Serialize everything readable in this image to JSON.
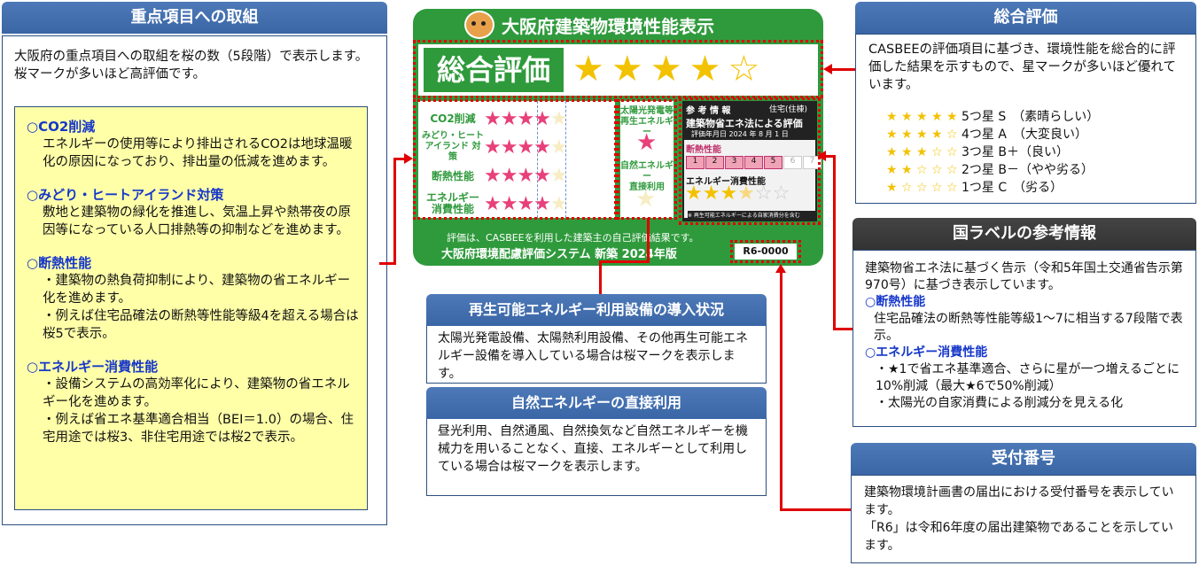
{
  "left": {
    "title": "重点項目への取組",
    "intro": "大阪府の重点項目への取組を桜の数（5段階）で表示します。桜マークが多いほど高評価です。",
    "sections": [
      {
        "heading": "○CO2削減",
        "body": "エネルギーの使用等により排出されるCO2は地球温暖化の原因になっており、排出量の低減を進めます。"
      },
      {
        "heading": "○みどり・ヒートアイランド対策",
        "body": "敷地と建築物の緑化を推進し、気温上昇や熱帯夜の原因等になっている人口排熱等の抑制などを進めます。"
      },
      {
        "heading": "○断熱性能",
        "body": "・建築物の熱負荷抑制により、建築物の省エネルギー化を進めます。\n・例えば住宅品確法の断熱等性能等級4を超える場合は桜5で表示。"
      },
      {
        "heading": "○エネルギー消費性能",
        "body": "・設備システムの高効率化により、建築物の省エネルギー化を進めます。\n・例えば省エネ基準適合相当（BEI＝1.0）の場合、住宅用途では桜3、非住宅用途では桜2で表示。"
      }
    ]
  },
  "label": {
    "title": "大阪府建築物環境性能表示",
    "overall": "総合評価",
    "overall_stars": 4,
    "rows": [
      {
        "label": "CO2削減",
        "sakura": 4
      },
      {
        "label": "みどり・ヒート\nアイランド 対策",
        "sakura": 4
      },
      {
        "label": "断熱性能",
        "sakura": 4
      },
      {
        "label": "エネルギー\n消費性能",
        "sakura": 4
      }
    ],
    "renewable": "太陽光発電等\n再生エネルギー",
    "natural": "自然エネルギー\n直接利用",
    "ref_header_left": "参 考 情 報",
    "ref_header_right": "住宅(住棟)",
    "ref_title": "建築物省エネ法による評価",
    "ref_date": "評価年月日 2024 年 8 月 1 日",
    "insulation_label": "断熱性能",
    "insulation_levels": [
      "1",
      "2",
      "3",
      "4",
      "5",
      "6",
      "7"
    ],
    "insulation_grade": 5,
    "energy_label": "エネルギー消費性能",
    "energy_stars": 3.5,
    "ref_footer": "※ 再生可能エネルギーによる自家消費分を含む",
    "footer1": "評価は、CASBEEを利用した建築主の自己評価結果です。",
    "footer2": "大阪府環境配慮評価システム 新築 2024年版",
    "reg_no": "R6-0000"
  },
  "renewable_box": {
    "title": "再生可能エネルギー利用設備の導入状況",
    "body": "太陽光発電設備、太陽熱利用設備、その他再生可能エネルギー設備を導入している場合は桜マークを表示します。"
  },
  "natural_box": {
    "title": "自然エネルギーの直接利用",
    "body": "昼光利用、自然通風、自然換気など自然エネルギーを機械力を用いることなく、直接、エネルギーとして利用している場合は桜マークを表示します。"
  },
  "overall_box": {
    "title": "総合評価",
    "body": "CASBEEの評価項目に基づき、環境性能を総合的に評価した結果を示すもので、星マークが多いほど優れています。",
    "ranks": [
      {
        "stars": "★ ★ ★ ★ ★",
        "text": "5つ星 S　（素晴らしい）"
      },
      {
        "stars": "★ ★ ★ ★ ☆",
        "text": "4つ星 A　（大変良い）"
      },
      {
        "stars": "★ ★ ★ ☆ ☆",
        "text": "3つ星 B＋（良い）"
      },
      {
        "stars": "★ ★ ☆ ☆ ☆",
        "text": "2つ星 B－（やや劣る）"
      },
      {
        "stars": "★ ☆ ☆ ☆ ☆",
        "text": "1つ星 C　（劣る）"
      }
    ]
  },
  "national_box": {
    "title": "国ラベルの参考情報",
    "intro": "建築物省エネ法に基づく告示（令和5年国土交通省告示第970号）に基づき表示しています。",
    "h1": "○断熱性能",
    "b1": "住宅品確法の断熱等性能等級1～7に相当する7段階で表示。",
    "h2": "○エネルギー消費性能",
    "b2": "・★1で省エネ基準適合、さらに星が一つ増えるごとに10%削減（最大★6で50%削減）\n・太陽光の自家消費による削減分を見える化"
  },
  "reception_box": {
    "title": "受付番号",
    "body": "建築物環境計画書の届出における受付番号を表示しています。\n「R6」は令和6年度の届出建築物であることを示しています。"
  },
  "colors": {
    "header_blue": "#3a66a6",
    "label_green": "#2f9a3c",
    "red": "#e00000",
    "yellow": "#ffffa8",
    "sakura": "#e8407a",
    "star": "#f2c200"
  }
}
